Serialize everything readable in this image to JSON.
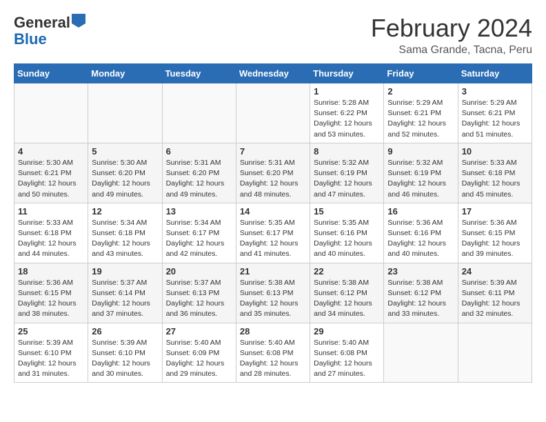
{
  "header": {
    "logo_line1": "General",
    "logo_line2": "Blue",
    "month": "February 2024",
    "location": "Sama Grande, Tacna, Peru"
  },
  "days_of_week": [
    "Sunday",
    "Monday",
    "Tuesday",
    "Wednesday",
    "Thursday",
    "Friday",
    "Saturday"
  ],
  "weeks": [
    [
      {
        "num": "",
        "info": ""
      },
      {
        "num": "",
        "info": ""
      },
      {
        "num": "",
        "info": ""
      },
      {
        "num": "",
        "info": ""
      },
      {
        "num": "1",
        "info": "Sunrise: 5:28 AM\nSunset: 6:22 PM\nDaylight: 12 hours and 53 minutes."
      },
      {
        "num": "2",
        "info": "Sunrise: 5:29 AM\nSunset: 6:21 PM\nDaylight: 12 hours and 52 minutes."
      },
      {
        "num": "3",
        "info": "Sunrise: 5:29 AM\nSunset: 6:21 PM\nDaylight: 12 hours and 51 minutes."
      }
    ],
    [
      {
        "num": "4",
        "info": "Sunrise: 5:30 AM\nSunset: 6:21 PM\nDaylight: 12 hours and 50 minutes."
      },
      {
        "num": "5",
        "info": "Sunrise: 5:30 AM\nSunset: 6:20 PM\nDaylight: 12 hours and 49 minutes."
      },
      {
        "num": "6",
        "info": "Sunrise: 5:31 AM\nSunset: 6:20 PM\nDaylight: 12 hours and 49 minutes."
      },
      {
        "num": "7",
        "info": "Sunrise: 5:31 AM\nSunset: 6:20 PM\nDaylight: 12 hours and 48 minutes."
      },
      {
        "num": "8",
        "info": "Sunrise: 5:32 AM\nSunset: 6:19 PM\nDaylight: 12 hours and 47 minutes."
      },
      {
        "num": "9",
        "info": "Sunrise: 5:32 AM\nSunset: 6:19 PM\nDaylight: 12 hours and 46 minutes."
      },
      {
        "num": "10",
        "info": "Sunrise: 5:33 AM\nSunset: 6:18 PM\nDaylight: 12 hours and 45 minutes."
      }
    ],
    [
      {
        "num": "11",
        "info": "Sunrise: 5:33 AM\nSunset: 6:18 PM\nDaylight: 12 hours and 44 minutes."
      },
      {
        "num": "12",
        "info": "Sunrise: 5:34 AM\nSunset: 6:18 PM\nDaylight: 12 hours and 43 minutes."
      },
      {
        "num": "13",
        "info": "Sunrise: 5:34 AM\nSunset: 6:17 PM\nDaylight: 12 hours and 42 minutes."
      },
      {
        "num": "14",
        "info": "Sunrise: 5:35 AM\nSunset: 6:17 PM\nDaylight: 12 hours and 41 minutes."
      },
      {
        "num": "15",
        "info": "Sunrise: 5:35 AM\nSunset: 6:16 PM\nDaylight: 12 hours and 40 minutes."
      },
      {
        "num": "16",
        "info": "Sunrise: 5:36 AM\nSunset: 6:16 PM\nDaylight: 12 hours and 40 minutes."
      },
      {
        "num": "17",
        "info": "Sunrise: 5:36 AM\nSunset: 6:15 PM\nDaylight: 12 hours and 39 minutes."
      }
    ],
    [
      {
        "num": "18",
        "info": "Sunrise: 5:36 AM\nSunset: 6:15 PM\nDaylight: 12 hours and 38 minutes."
      },
      {
        "num": "19",
        "info": "Sunrise: 5:37 AM\nSunset: 6:14 PM\nDaylight: 12 hours and 37 minutes."
      },
      {
        "num": "20",
        "info": "Sunrise: 5:37 AM\nSunset: 6:13 PM\nDaylight: 12 hours and 36 minutes."
      },
      {
        "num": "21",
        "info": "Sunrise: 5:38 AM\nSunset: 6:13 PM\nDaylight: 12 hours and 35 minutes."
      },
      {
        "num": "22",
        "info": "Sunrise: 5:38 AM\nSunset: 6:12 PM\nDaylight: 12 hours and 34 minutes."
      },
      {
        "num": "23",
        "info": "Sunrise: 5:38 AM\nSunset: 6:12 PM\nDaylight: 12 hours and 33 minutes."
      },
      {
        "num": "24",
        "info": "Sunrise: 5:39 AM\nSunset: 6:11 PM\nDaylight: 12 hours and 32 minutes."
      }
    ],
    [
      {
        "num": "25",
        "info": "Sunrise: 5:39 AM\nSunset: 6:10 PM\nDaylight: 12 hours and 31 minutes."
      },
      {
        "num": "26",
        "info": "Sunrise: 5:39 AM\nSunset: 6:10 PM\nDaylight: 12 hours and 30 minutes."
      },
      {
        "num": "27",
        "info": "Sunrise: 5:40 AM\nSunset: 6:09 PM\nDaylight: 12 hours and 29 minutes."
      },
      {
        "num": "28",
        "info": "Sunrise: 5:40 AM\nSunset: 6:08 PM\nDaylight: 12 hours and 28 minutes."
      },
      {
        "num": "29",
        "info": "Sunrise: 5:40 AM\nSunset: 6:08 PM\nDaylight: 12 hours and 27 minutes."
      },
      {
        "num": "",
        "info": ""
      },
      {
        "num": "",
        "info": ""
      }
    ]
  ]
}
